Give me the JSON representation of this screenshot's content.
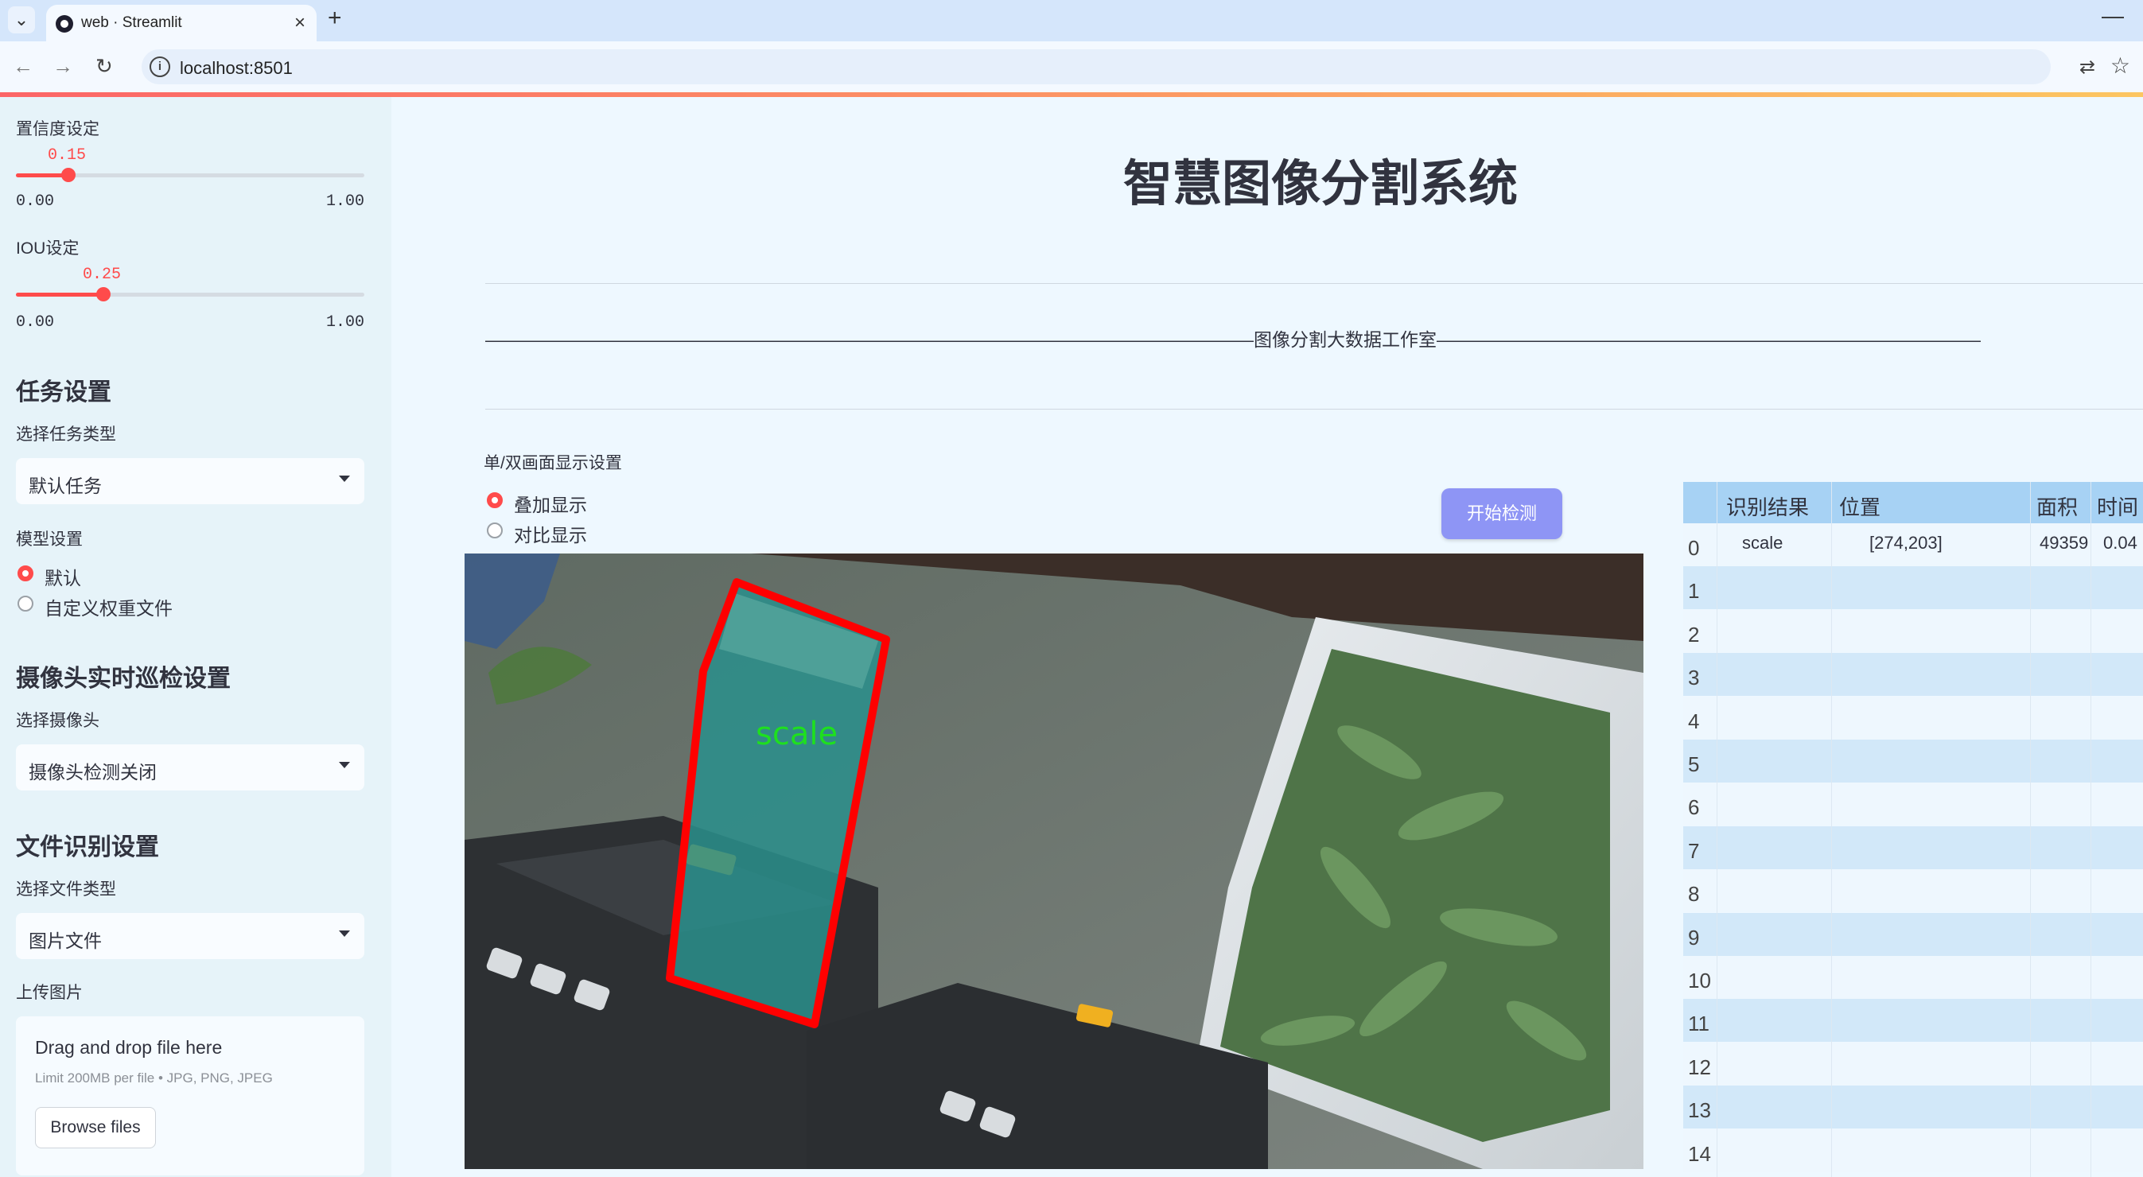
{
  "browser": {
    "tab_title": "web · Streamlit",
    "url": "localhost:8501"
  },
  "sidebar": {
    "confidence": {
      "label": "置信度设定",
      "value": "0.15",
      "value_num": 0.15,
      "min": "0.00",
      "max": "1.00"
    },
    "iou": {
      "label": "IOU设定",
      "value": "0.25",
      "value_num": 0.25,
      "min": "0.00",
      "max": "1.00"
    },
    "task_header": "任务设置",
    "task_type_label": "选择任务类型",
    "task_type_value": "默认任务",
    "model_label": "模型设置",
    "model_options": [
      "默认",
      "自定义权重文件"
    ],
    "camera_header": "摄像头实时巡检设置",
    "camera_label": "选择摄像头",
    "camera_value": "摄像头检测关闭",
    "file_header": "文件识别设置",
    "file_type_label": "选择文件类型",
    "file_type_value": "图片文件",
    "upload_label": "上传图片",
    "upload_drag": "Drag and drop file here",
    "upload_limit": "Limit 200MB per file • JPG, PNG, JPEG",
    "upload_browse": "Browse files"
  },
  "main": {
    "title": "智慧图像分割系统",
    "subtitle": "——————————————————————————————————————————图像分割大数据工作室——————————————————————————————————————————",
    "display_label": "单/双画面显示设置",
    "display_options": [
      "叠加显示",
      "对比显示"
    ],
    "start_button": "开始检测",
    "detection_label": "scale"
  },
  "table": {
    "headers": [
      "识别结果",
      "位置",
      "面积",
      "时间"
    ],
    "rows": [
      {
        "idx": "0",
        "result": "scale",
        "position": "[274,203]",
        "area": "49359",
        "time": "0.04"
      },
      {
        "idx": "1"
      },
      {
        "idx": "2"
      },
      {
        "idx": "3"
      },
      {
        "idx": "4"
      },
      {
        "idx": "5"
      },
      {
        "idx": "6"
      },
      {
        "idx": "7"
      },
      {
        "idx": "8"
      },
      {
        "idx": "9"
      },
      {
        "idx": "10"
      },
      {
        "idx": "11"
      },
      {
        "idx": "12"
      },
      {
        "idx": "13"
      },
      {
        "idx": "14"
      }
    ]
  },
  "colors": {
    "accent": "#ff4b4b",
    "button": "#8e95f5",
    "table_header": "#a7d2f4",
    "table_stripe": "#d2e8f9",
    "detection_box": "#ff0000",
    "detection_text": "#1ee01e"
  }
}
